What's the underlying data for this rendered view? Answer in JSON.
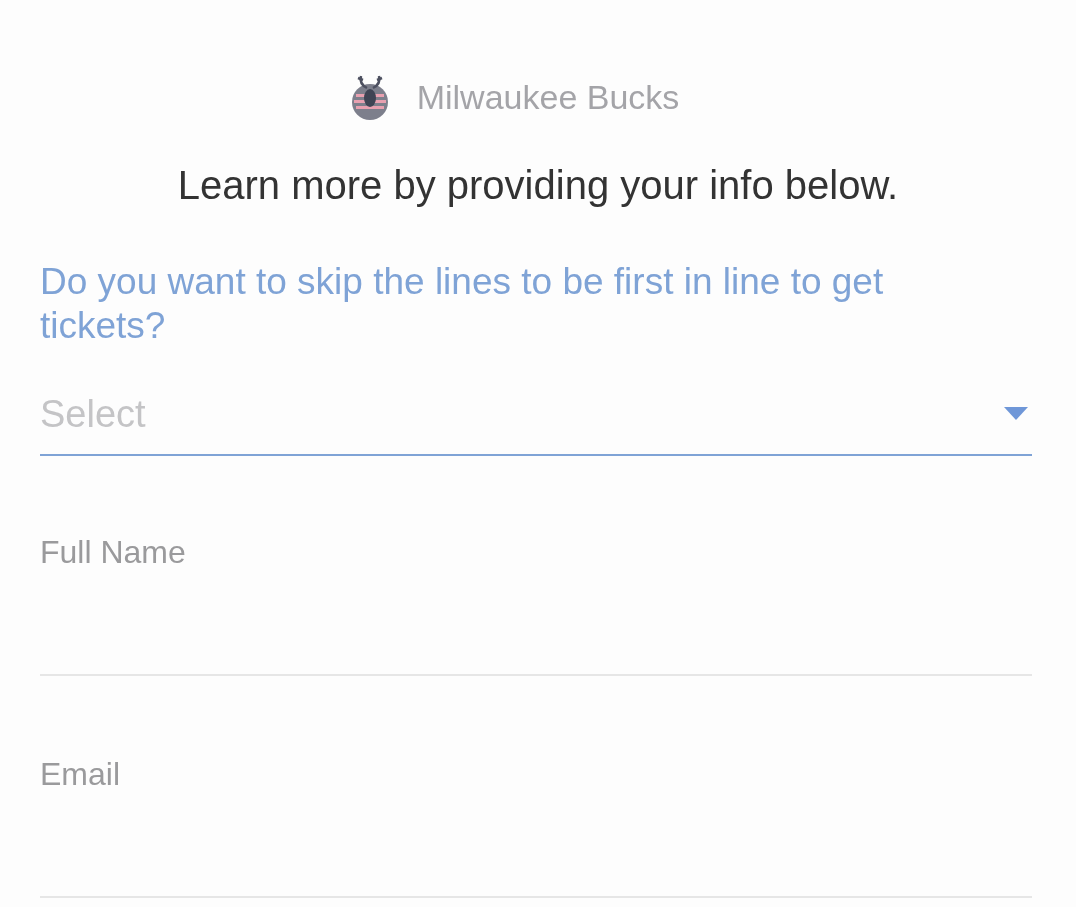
{
  "header": {
    "team_name": "Milwaukee Bucks"
  },
  "intro": "Learn more by providing your info below.",
  "question": "Do you want to skip the lines to be first in line to get tickets?",
  "fields": [
    {
      "kind": "select",
      "placeholder": "Select",
      "focused": true
    },
    {
      "kind": "text",
      "label": "Full Name",
      "focused": false
    },
    {
      "kind": "text",
      "label": "Email",
      "focused": false
    }
  ]
}
